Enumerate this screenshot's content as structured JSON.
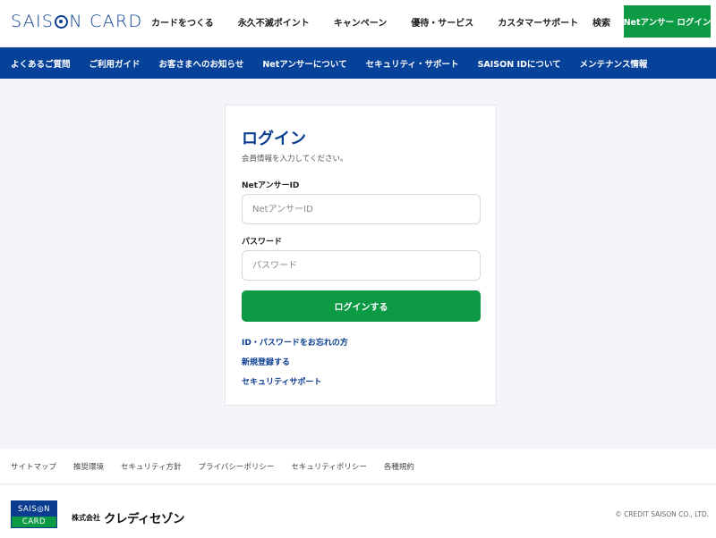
{
  "header": {
    "logo_left": "SAIS",
    "logo_right": "N CARD",
    "nav": [
      "カードをつくる",
      "永久不滅ポイント",
      "キャンペーン",
      "優待・サービス",
      "カスタマーサポート"
    ],
    "search_label": "検索",
    "login_button": "Netアンサー ログイン"
  },
  "subnav": [
    "よくあるご質問",
    "ご利用ガイド",
    "お客さまへのお知らせ",
    "Netアンサーについて",
    "セキュリティ・サポート",
    "SAISON IDについて",
    "メンテナンス情報"
  ],
  "login": {
    "title": "ログイン",
    "description": "会員情報を入力してください。",
    "id_label": "NetアンサーID",
    "id_placeholder": "NetアンサーID",
    "password_label": "パスワード",
    "password_placeholder": "パスワード",
    "submit_label": "ログインする",
    "links": [
      "ID・パスワードをお忘れの方",
      "新規登録する",
      "セキュリティサポート"
    ]
  },
  "footer": {
    "links": [
      "サイトマップ",
      "推奨環境",
      "セキュリティ方針",
      "プライバシーポリシー",
      "セキュリティポリシー",
      "各種規約"
    ],
    "badge_top": "SAIS◎N",
    "badge_bottom": "CARD",
    "company_prefix": "株式会社",
    "company_name": "クレディセゾン",
    "copyright": "© CREDIT SAISON CO., LTD."
  },
  "colors": {
    "brand_blue": "#06419a",
    "accent_green": "#0d9a45",
    "background": "#f4f5f8"
  }
}
